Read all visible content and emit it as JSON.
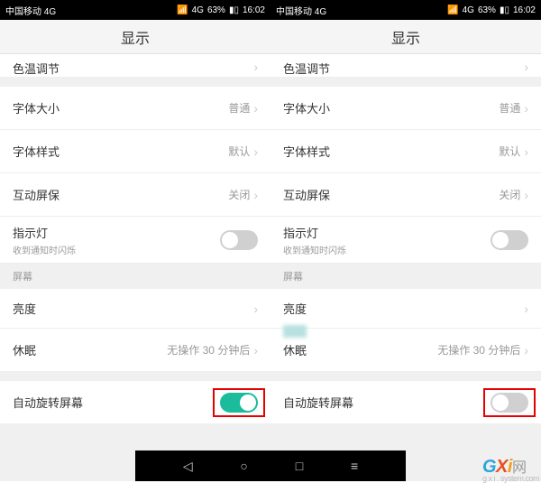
{
  "status": {
    "carrier": "中国移动 4G",
    "battery": "63%",
    "time": "16:02",
    "net_indicator": "4G"
  },
  "title": "显示",
  "rows": {
    "color_temp": "色温调节",
    "font_size": {
      "label": "字体大小",
      "value": "普通"
    },
    "font_style": {
      "label": "字体样式",
      "value": "默认"
    },
    "daydream": {
      "label": "互动屏保",
      "value": "关闭"
    },
    "led": {
      "label": "指示灯",
      "sub": "收到通知时闪烁"
    },
    "section_screen": "屏幕",
    "brightness": "亮度",
    "sleep": {
      "label": "休眠",
      "value": "无操作 30 分钟后"
    },
    "auto_rotate": "自动旋转屏幕"
  },
  "screens": {
    "left_rotate_on": true,
    "right_rotate_on": false
  },
  "watermark": {
    "brand": "GXI",
    "suffix": "网",
    "domain": "g x i . system.com"
  }
}
